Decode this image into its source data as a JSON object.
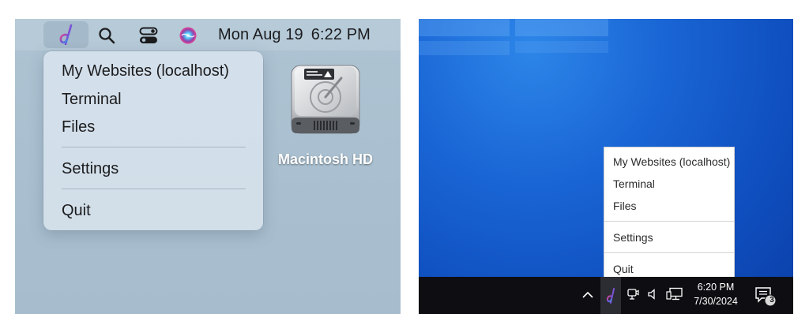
{
  "mac": {
    "menubar": {
      "clock_day_date": "Mon Aug 19",
      "clock_time": "6:22 PM",
      "icons": [
        "app-d-icon",
        "search-icon",
        "control-center-icon",
        "siri-icon"
      ]
    },
    "menu": {
      "items": [
        "My Websites (localhost)",
        "Terminal",
        "Files",
        "Settings",
        "Quit"
      ]
    },
    "desktop": {
      "drive_label": "Macintosh HD",
      "drive_icon": "hard-drive-icon"
    }
  },
  "windows": {
    "menu": {
      "items": [
        "My Websites (localhost)",
        "Terminal",
        "Files",
        "Settings",
        "Quit"
      ]
    },
    "taskbar": {
      "time": "6:20 PM",
      "date": "7/30/2024",
      "notification_count": "3",
      "icons": [
        "chevron-up-icon",
        "app-d-icon",
        "meet-now-icon",
        "volume-icon",
        "network-icon",
        "action-center-icon"
      ]
    },
    "colors": {
      "desktop_blue": "#1a66d6",
      "taskbar": "#0e0e12"
    }
  }
}
